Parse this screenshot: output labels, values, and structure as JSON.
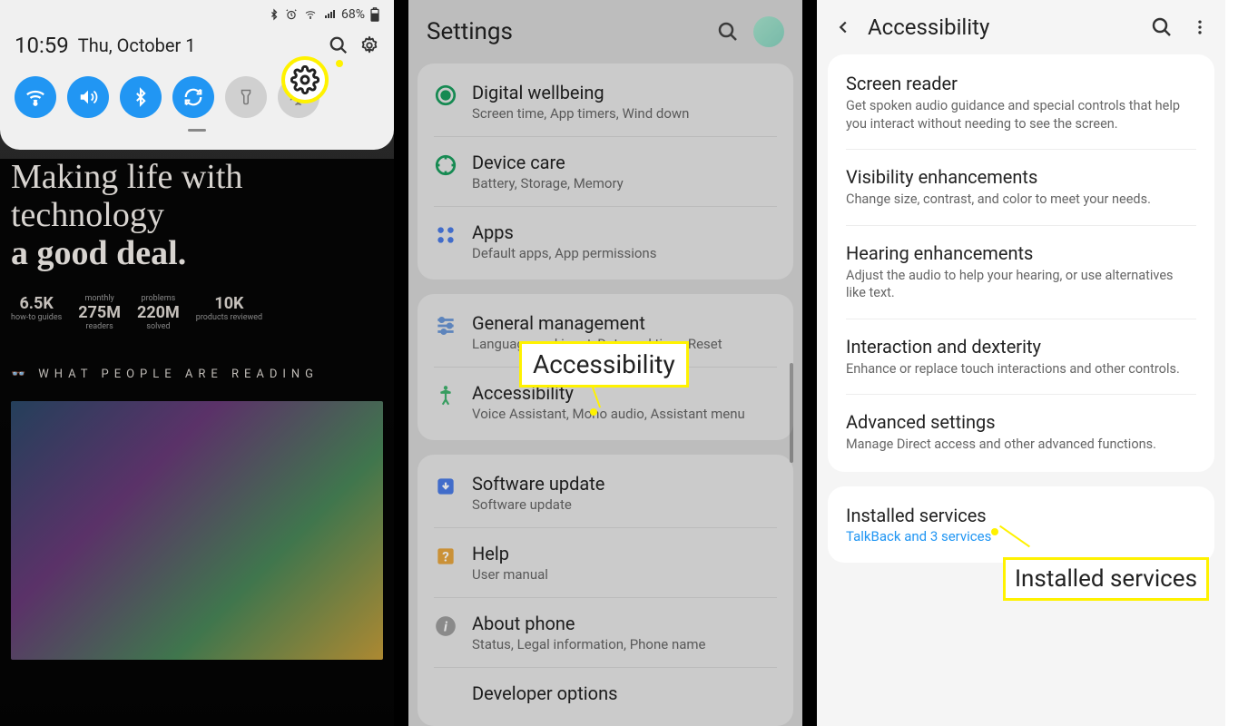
{
  "panel1": {
    "status": {
      "battery_pct": "68%",
      "time": "10:59",
      "date": "Thu, October 1"
    },
    "qs_toggles": [
      {
        "name": "wifi",
        "active": true
      },
      {
        "name": "volume",
        "active": true
      },
      {
        "name": "bluetooth",
        "active": true
      },
      {
        "name": "rotate",
        "active": true
      },
      {
        "name": "flashlight",
        "active": false
      },
      {
        "name": "airplane",
        "active": false
      }
    ],
    "home": {
      "headline_a": "Making life with technology",
      "headline_b": "a good deal.",
      "stats": [
        {
          "label": "",
          "num": "6.5K",
          "sub": "how-to guides"
        },
        {
          "label": "monthly",
          "num": "275M",
          "sub": "readers"
        },
        {
          "label": "problems",
          "num": "220M",
          "sub": "solved"
        },
        {
          "label": "",
          "num": "10K",
          "sub": "products reviewed"
        }
      ],
      "reading_hdr": "WHAT PEOPLE ARE READING"
    }
  },
  "panel2": {
    "title": "Settings",
    "groups": [
      [
        {
          "icon": "wellbeing",
          "title": "Digital wellbeing",
          "sub": "Screen time, App timers, Wind down"
        },
        {
          "icon": "device-care",
          "title": "Device care",
          "sub": "Battery, Storage, Memory"
        },
        {
          "icon": "apps",
          "title": "Apps",
          "sub": "Default apps, App permissions"
        }
      ],
      [
        {
          "icon": "general",
          "title": "General management",
          "sub": "Language and input, Date and time, Reset"
        },
        {
          "icon": "accessibility",
          "title": "Accessibility",
          "sub": "Voice Assistant, Mono audio, Assistant menu"
        }
      ],
      [
        {
          "icon": "update",
          "title": "Software update",
          "sub": "Software update"
        },
        {
          "icon": "help",
          "title": "Help",
          "sub": "User manual"
        },
        {
          "icon": "about",
          "title": "About phone",
          "sub": "Status, Legal information, Phone name"
        },
        {
          "icon": "developer",
          "title": "Developer options",
          "sub": ""
        }
      ]
    ],
    "callout": "Accessibility"
  },
  "panel3": {
    "title": "Accessibility",
    "group1": [
      {
        "title": "Screen reader",
        "sub": "Get spoken audio guidance and special controls that help you interact without needing to see the screen."
      },
      {
        "title": "Visibility enhancements",
        "sub": "Change size, contrast, and color to meet your needs."
      },
      {
        "title": "Hearing enhancements",
        "sub": "Adjust the audio to help your hearing, or use alternatives like text."
      },
      {
        "title": "Interaction and dexterity",
        "sub": "Enhance or replace touch interactions and other controls."
      },
      {
        "title": "Advanced settings",
        "sub": "Manage Direct access and other advanced functions."
      }
    ],
    "group2": [
      {
        "title": "Installed services",
        "link": "TalkBack and 3 services"
      }
    ],
    "callout": "Installed services"
  }
}
